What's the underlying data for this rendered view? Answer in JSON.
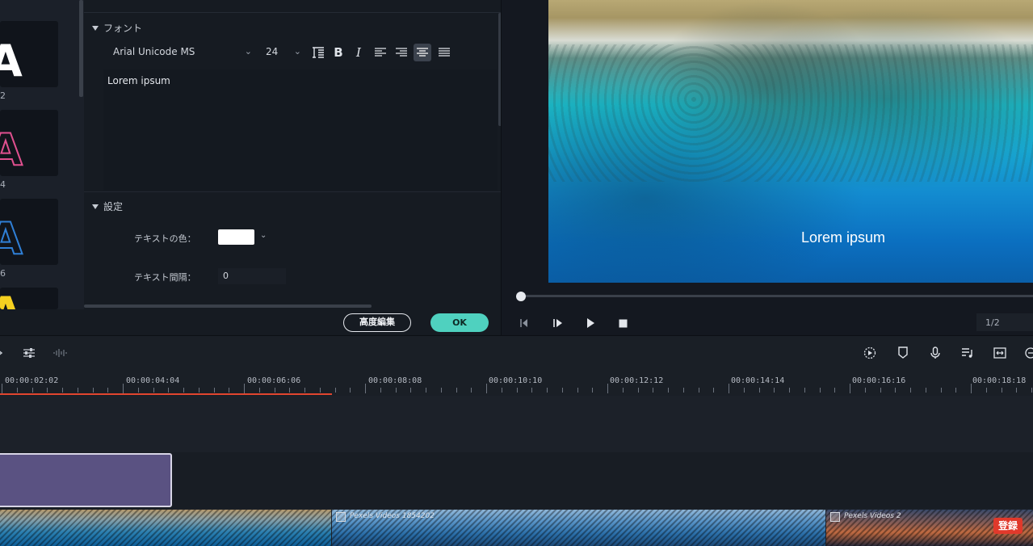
{
  "presets": [
    {
      "number": "2",
      "color": "#ffffff"
    },
    {
      "number": "4",
      "color": "#e0508f"
    },
    {
      "number": "6",
      "color": "#2f7fd6"
    },
    {
      "number": "",
      "color": "#f5d020"
    }
  ],
  "font_section": {
    "title": "フォント",
    "font_family": "Arial Unicode MS",
    "font_size": "24",
    "text_content": "Lorem ipsum",
    "tools": [
      "line-spacing-icon",
      "bold-icon",
      "italic-icon",
      "align-left-icon",
      "align-right-icon",
      "align-center-icon",
      "justify-icon"
    ],
    "bold_label": "B",
    "italic_label": "I"
  },
  "settings_section": {
    "title": "設定",
    "text_color_label": "テキストの色：",
    "text_color": "#ffffff",
    "text_spacing_label": "テキスト間隔：",
    "text_spacing_value": "0"
  },
  "buttons": {
    "advanced_edit": "高度編集",
    "ok": "OK"
  },
  "preview": {
    "overlay_text": "Lorem ipsum",
    "page_indicator": "1/2",
    "progress": 0.0
  },
  "timeline": {
    "timecodes": [
      "00:00:02:02",
      "00:00:04:04",
      "00:00:06:06",
      "00:00:08:08",
      "00:00:10:10",
      "00:00:12:12",
      "00:00:14:14",
      "00:00:16:16",
      "00:00:18:18"
    ],
    "clips": [
      {
        "label": "Pexels Videos 1854202"
      },
      {
        "label": "Pexels Videos 2"
      }
    ],
    "record_badge": "登録"
  },
  "colors": {
    "accent": "#4fd1bf",
    "playhead": "#e2452f",
    "title_clip": "#5a5282"
  }
}
